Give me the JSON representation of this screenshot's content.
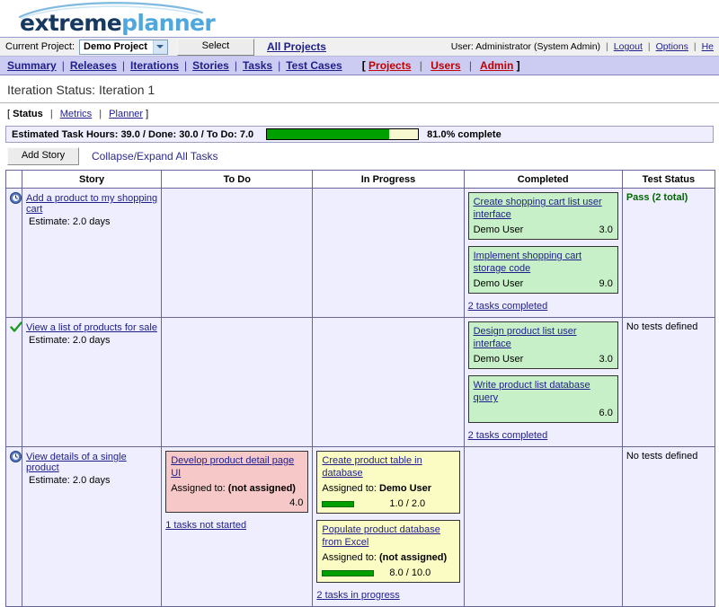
{
  "brand": {
    "name_part1": "extreme",
    "name_part2": "planner"
  },
  "project_bar": {
    "current_project_label": "Current Project:",
    "selected_project": "Demo Project",
    "select_button": "Select",
    "all_projects_link": "All Projects",
    "user_text": "User: Administrator (System Admin)",
    "logout_link": "Logout",
    "options_link": "Options",
    "help_link": "He"
  },
  "nav": {
    "items": [
      {
        "label": "Summary"
      },
      {
        "label": "Releases"
      },
      {
        "label": "Iterations"
      },
      {
        "label": "Stories"
      },
      {
        "label": "Tasks"
      },
      {
        "label": "Test Cases"
      }
    ],
    "admin_items": [
      {
        "label": "Projects"
      },
      {
        "label": "Users"
      },
      {
        "label": "Admin"
      }
    ],
    "bracket_open": "[",
    "bracket_close": "]",
    "separator": "|"
  },
  "page": {
    "title": "Iteration Status: Iteration 1"
  },
  "subtabs": {
    "bracket_open": "[",
    "bracket_close": "]",
    "items": [
      {
        "label": "Status",
        "active": true
      },
      {
        "label": "Metrics",
        "active": false
      },
      {
        "label": "Planner",
        "active": false
      }
    ]
  },
  "status": {
    "summary_text": "Estimated Task Hours:  39.0  /  Done:  30.0  /  To Do:  7.0",
    "estimated_hours": "39.0",
    "done_hours": "30.0",
    "todo_hours": "7.0",
    "percent_complete": 81.0,
    "percent_label": "81.0% complete",
    "bar_fill_color": "#00a000",
    "bar_track_color": "#f7f7d0"
  },
  "toolbar": {
    "add_story_label": "Add Story",
    "collapse_expand_label": "Collapse/Expand All Tasks"
  },
  "table": {
    "headers": [
      "",
      "Story",
      "To Do",
      "In Progress",
      "Completed",
      "Test Status"
    ],
    "rows": [
      {
        "icon": "clock-icon",
        "story_title": "Add a product to my shopping cart",
        "estimate": "Estimate: 2.0 days",
        "todo": {
          "cards": [],
          "footer": ""
        },
        "in_progress": {
          "cards": [],
          "footer": ""
        },
        "completed": {
          "cards": [
            {
              "title": "Create shopping cart list user interface",
              "assigned": "Demo User",
              "hours": "3.0"
            },
            {
              "title": "Implement shopping cart storage code",
              "assigned": "Demo User",
              "hours": "9.0"
            }
          ],
          "footer": "2 tasks completed"
        },
        "test_status": "Pass (2 total)",
        "test_status_kind": "pass"
      },
      {
        "icon": "check-icon",
        "story_title": "View a list of products for sale",
        "estimate": "Estimate: 2.0 days",
        "todo": {
          "cards": [],
          "footer": ""
        },
        "in_progress": {
          "cards": [],
          "footer": ""
        },
        "completed": {
          "cards": [
            {
              "title": "Design product list user interface",
              "assigned": "Demo User",
              "hours": "3.0"
            },
            {
              "title": "Write product list database query",
              "assigned": "",
              "hours": "6.0"
            }
          ],
          "footer": "2 tasks completed"
        },
        "test_status": "No tests defined",
        "test_status_kind": "none"
      },
      {
        "icon": "clock-icon",
        "story_title": "View details of a single product",
        "estimate": "Estimate: 2.0 days",
        "todo": {
          "cards": [
            {
              "title": "Develop product detail page UI",
              "assigned_label": "Assigned to:",
              "assigned": "(not assigned)",
              "hours": "4.0"
            }
          ],
          "footer": "1 tasks not started"
        },
        "in_progress": {
          "cards": [
            {
              "title": "Create product table in database",
              "assigned_label": "Assigned to:",
              "assigned": "Demo User",
              "progress_text": "1.0 / 2.0",
              "progress_pct": 50
            },
            {
              "title": "Populate product database from Excel",
              "assigned_label": "Assigned to:",
              "assigned": "(not assigned)",
              "progress_text": "8.0 / 10.0",
              "progress_pct": 80
            }
          ],
          "footer": "2 tasks in progress"
        },
        "completed": {
          "cards": [],
          "footer": ""
        },
        "test_status": "No tests defined",
        "test_status_kind": "none"
      }
    ]
  }
}
